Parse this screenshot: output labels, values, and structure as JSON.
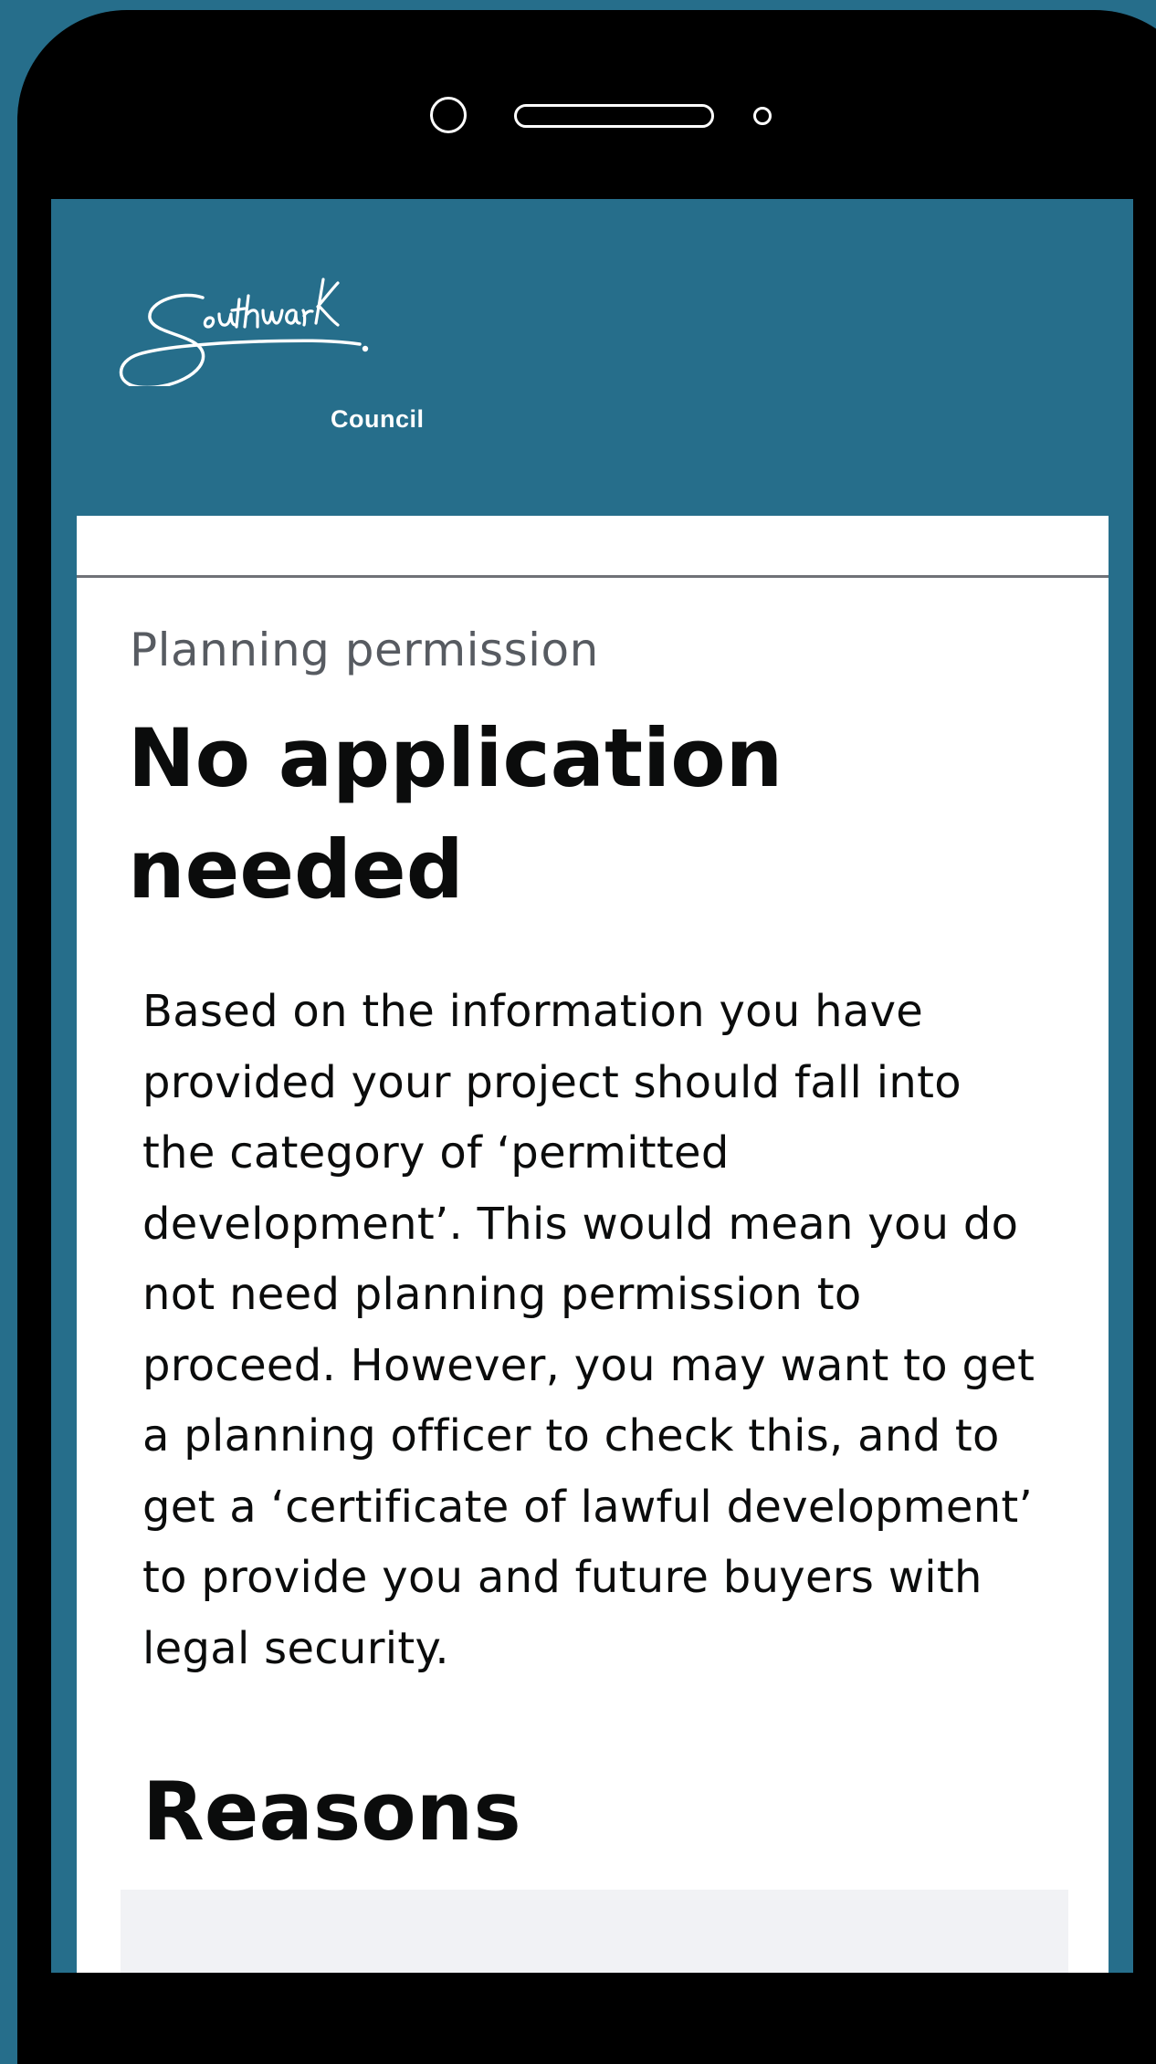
{
  "brand": {
    "logo_script": "Southwark",
    "logo_council": "Council"
  },
  "card": {
    "eyebrow": "Planning permission",
    "title": "No application needed",
    "body": "Based on the information you have provided your project should fall into the category of ‘permitted development’. This would mean you do not need planning permission to proceed. However, you may want to get a planning officer to check this, and to get a ‘certificate of lawful development’ to provide you and future buyers with legal security.",
    "reasons_heading": "Reasons"
  },
  "colors": {
    "background": "#266e8b",
    "phone_frame": "#000000",
    "card": "#ffffff",
    "text": "#0b0c0c",
    "muted_text": "#575b61",
    "panel": "#f1f2f5"
  }
}
